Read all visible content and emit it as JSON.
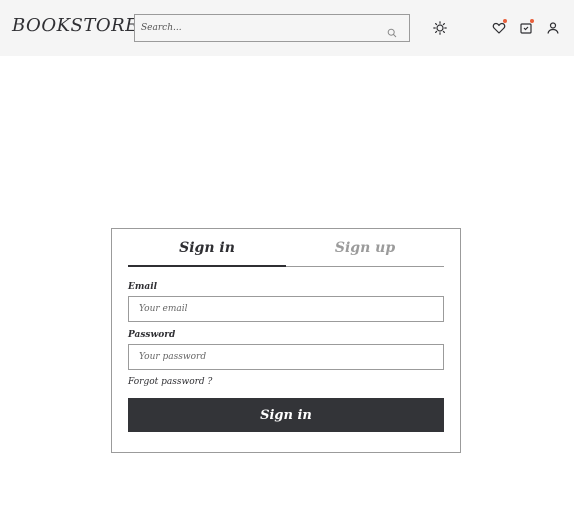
{
  "header": {
    "logo": "BOOKSTORE",
    "search_placeholder": "Search...",
    "icons": [
      "search-icon",
      "theme-toggle-icon",
      "wishlist-heart-icon",
      "cart-icon",
      "user-icon"
    ],
    "badge_color": "#e8603c"
  },
  "auth": {
    "tabs": [
      {
        "label": "Sign in",
        "active": true
      },
      {
        "label": "Sign up",
        "active": false
      }
    ],
    "email_label": "Email",
    "email_placeholder": "Your email",
    "password_label": "Password",
    "password_placeholder": "Your password",
    "forgot_link": "Forgot password ?",
    "submit_label": "Sign in"
  },
  "colors": {
    "header_bg": "#f5f5f5",
    "primary_dark": "#333438",
    "inactive_tab": "#9b9b9b"
  }
}
